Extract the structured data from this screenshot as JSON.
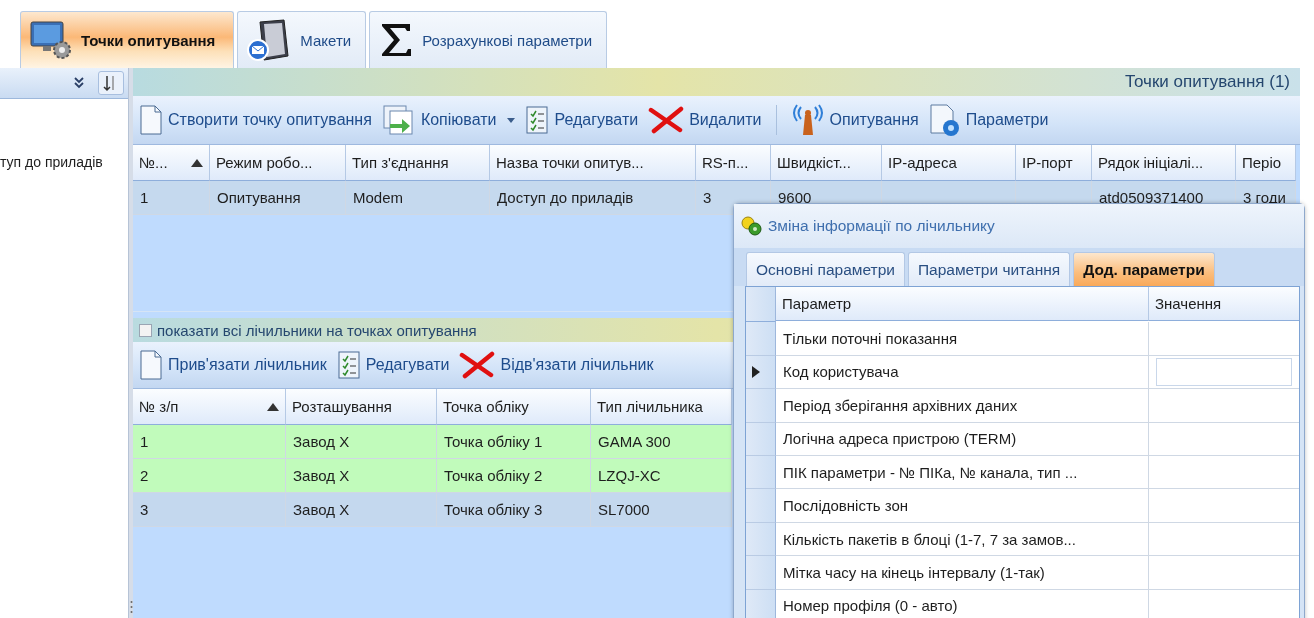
{
  "main_tabs": [
    {
      "label": "Точки опитування",
      "kind": "monitor",
      "selected": true
    },
    {
      "label": "Макети",
      "kind": "server",
      "selected": false
    },
    {
      "label": "Розрахункові параметри",
      "kind": "sigma",
      "selected": false
    }
  ],
  "left_panel": {
    "text": "туп до приладів"
  },
  "polling_points": {
    "caption": "Точки опитування (1)",
    "toolbar": [
      {
        "label": "Створити точку опитування",
        "kind": "page",
        "dropdown": false
      },
      {
        "label": "Копіювати",
        "kind": "copy",
        "dropdown": true
      },
      {
        "label": "Редагувати",
        "kind": "list",
        "dropdown": false
      },
      {
        "label": "Видалити",
        "kind": "cross",
        "dropdown": false
      },
      {
        "kind": "separator"
      },
      {
        "label": "Опитування",
        "kind": "antenna",
        "dropdown": false
      },
      {
        "label": "Параметри",
        "kind": "docgear",
        "dropdown": false
      }
    ],
    "columns": [
      {
        "label": "№...",
        "sorted": true
      },
      {
        "label": "Режим робо...",
        "sorted": false
      },
      {
        "label": "Тип з'єднання",
        "sorted": false
      },
      {
        "label": "Назва точки опитув...",
        "sorted": false
      },
      {
        "label": "RS-п...",
        "sorted": false
      },
      {
        "label": "Швидкіст...",
        "sorted": false
      },
      {
        "label": "IP-адреса",
        "sorted": false
      },
      {
        "label": "IP-порт",
        "sorted": false
      },
      {
        "label": "Рядок ініціалі...",
        "sorted": false
      },
      {
        "label": "Періо",
        "sorted": false
      }
    ],
    "rows": [
      {
        "selected": true,
        "cells": [
          "1",
          "Опитування",
          "Modem",
          "Доступ до приладів",
          "3",
          "9600",
          "",
          "",
          "atd0509371400",
          "3 годи"
        ]
      }
    ]
  },
  "meters": {
    "show_all": {
      "label": "показати всі лічильники на точках опитування",
      "checked": false
    },
    "toolbar": [
      {
        "label": "Прив'язати лічильник",
        "kind": "page"
      },
      {
        "label": "Редагувати",
        "kind": "list"
      },
      {
        "label": "Відв'язати лічильник",
        "kind": "cross"
      }
    ],
    "columns": [
      {
        "label": "№ з/п",
        "sorted": true
      },
      {
        "label": "Розташування",
        "sorted": false
      },
      {
        "label": "Точка обліку",
        "sorted": false
      },
      {
        "label": "Тип лічильника",
        "sorted": false
      }
    ],
    "rows": [
      {
        "color": "#c1fbbb",
        "cells": [
          "1",
          "Завод X",
          "Точка обліку 1",
          "GAMA 300"
        ]
      },
      {
        "color": "#c1fbbb",
        "cells": [
          "2",
          "Завод X",
          "Точка обліку 2",
          "LZQJ-XC"
        ]
      },
      {
        "color": "#c4d8ee",
        "cells": [
          "3",
          "Завод X",
          "Точка обліку 3",
          "SL7000"
        ]
      }
    ]
  },
  "dialog": {
    "title": "Зміна інформації по лічильнику",
    "tabs": [
      {
        "label": "Основні параметри",
        "selected": false
      },
      {
        "label": "Параметри читання",
        "selected": false
      },
      {
        "label": "Дод. параметри",
        "selected": true
      }
    ],
    "columns": [
      "Параметр",
      "Значення"
    ],
    "rows": [
      {
        "parameter": "Тільки поточні показання",
        "value": "",
        "current": false
      },
      {
        "parameter": "Код користувача",
        "value": "",
        "current": true
      },
      {
        "parameter": "Період зберігання архівних даних",
        "value": "",
        "current": false
      },
      {
        "parameter": "Логічна адреса пристрою (TERM)",
        "value": "",
        "current": false
      },
      {
        "parameter": "ПІК параметри - № ПІКа, № канала, тип ...",
        "value": "",
        "current": false
      },
      {
        "parameter": "Послідовність зон",
        "value": "",
        "current": false
      },
      {
        "parameter": "Кількість пакетів в блоці (1-7, 7 за замов...",
        "value": "",
        "current": false
      },
      {
        "parameter": "Мітка часу на кінець інтервалу (1-так)",
        "value": "",
        "current": false
      },
      {
        "parameter": "Номер профіля (0 - авто)",
        "value": "",
        "current": false
      }
    ]
  }
}
